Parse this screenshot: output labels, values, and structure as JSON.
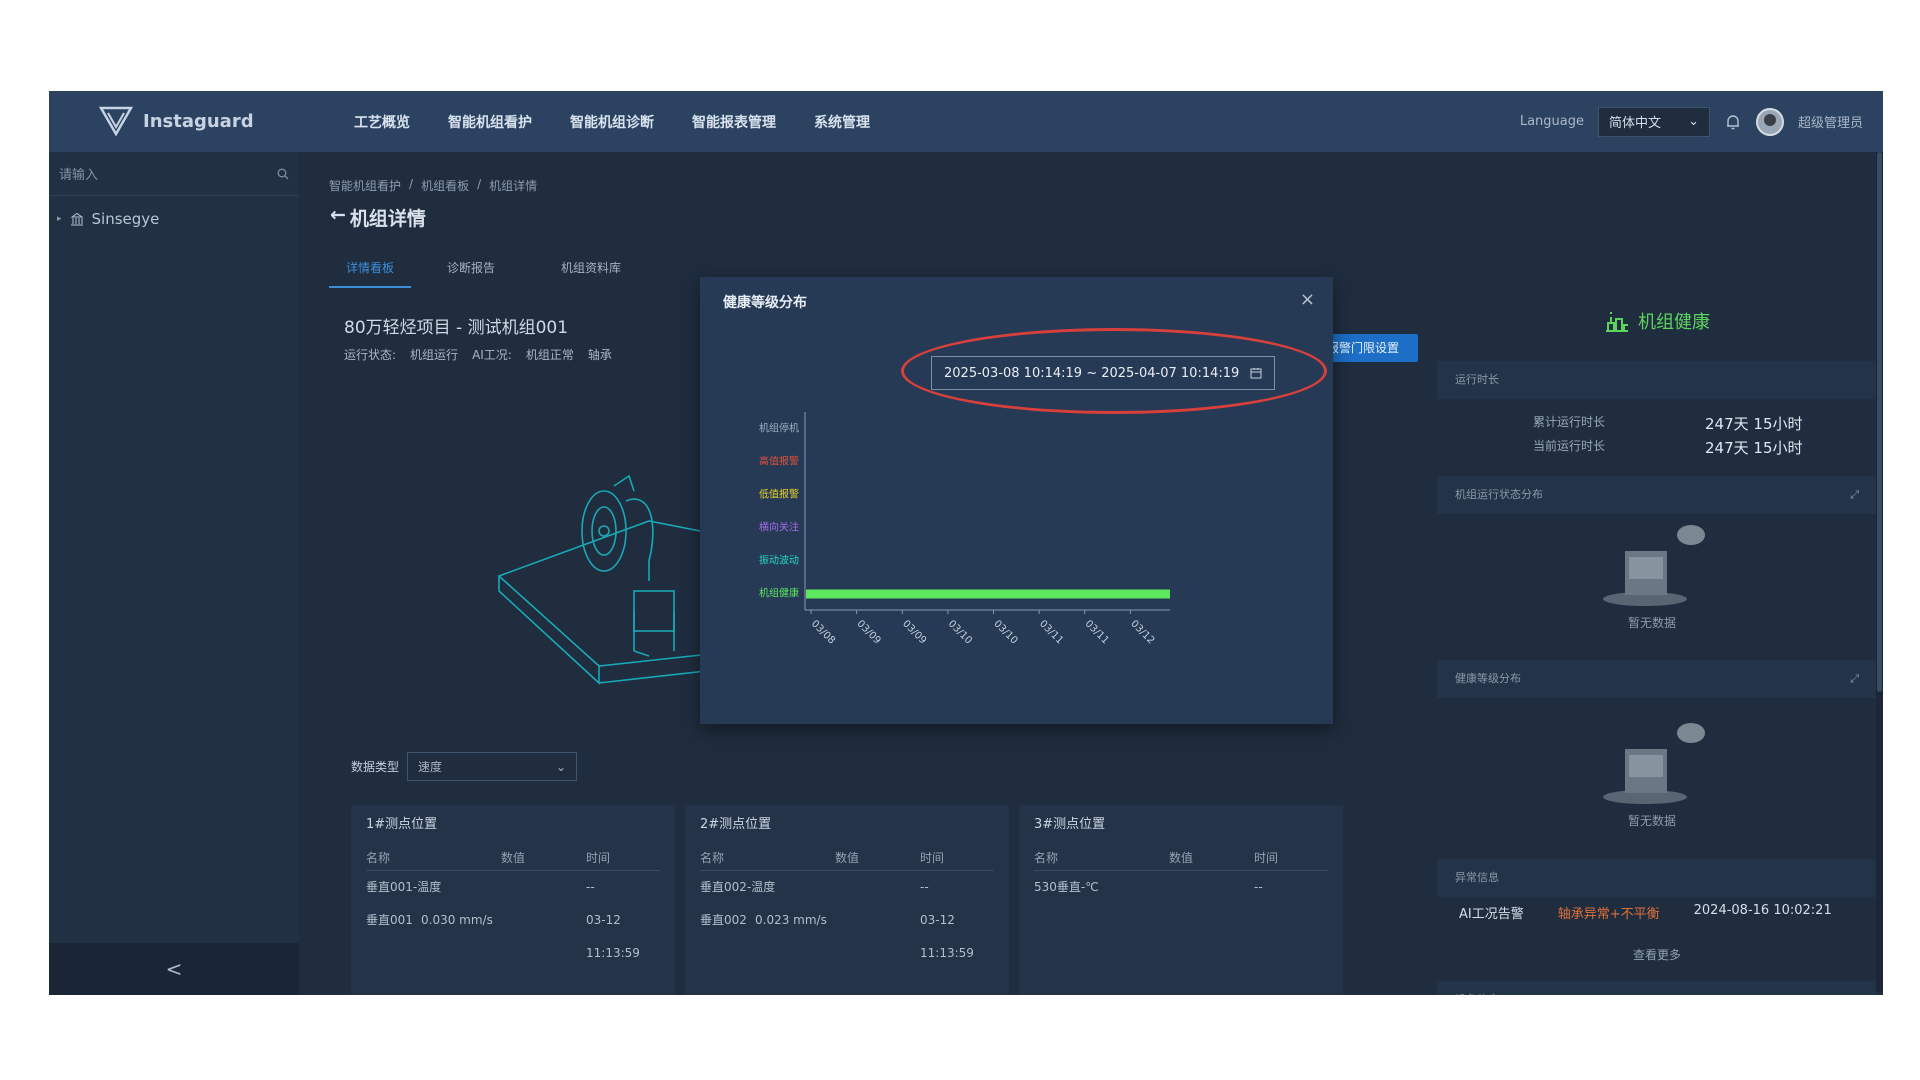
{
  "app": {
    "brand": "Instaguard"
  },
  "nav": {
    "items": [
      "工艺概览",
      "智能机组看护",
      "智能机组诊断",
      "智能报表管理",
      "系统管理"
    ]
  },
  "topright": {
    "language_label": "Language",
    "language_value": "简体中文",
    "user": "超级管理员"
  },
  "sidebar": {
    "search_placeholder": "请输入",
    "tree_root": "Sinsegye",
    "collapse": "<"
  },
  "breadcrumb": [
    "智能机组看护",
    "/",
    "机组看板",
    "/",
    "机组详情"
  ],
  "page": {
    "title": "机组详情",
    "tabs": [
      "详情看板",
      "诊断报告",
      "机组资料库"
    ],
    "project": "80万轻烃项目 - 测试机组001",
    "status": {
      "run_label": "运行状态:",
      "run_value": "机组运行",
      "ai_label": "AI工况:",
      "ai_value": "机组正常",
      "bearing_label": "轴承"
    },
    "alarm_button": "报警门限设置",
    "data_type_label": "数据类型",
    "data_type_value": "速度"
  },
  "measure_points": [
    {
      "title": "1#测点位置",
      "headers": [
        "名称",
        "数值",
        "时间"
      ],
      "rows": [
        [
          "垂直001-温度",
          "",
          "--"
        ],
        [
          "垂直001",
          "0.030 mm/s",
          "03-12 11:13:59"
        ]
      ]
    },
    {
      "title": "2#测点位置",
      "headers": [
        "名称",
        "数值",
        "时间"
      ],
      "rows": [
        [
          "垂直002-温度",
          "",
          "--"
        ],
        [
          "垂直002",
          "0.023 mm/s",
          "03-12 11:13:59"
        ]
      ]
    },
    {
      "title": "3#测点位置",
      "headers": [
        "名称",
        "数值",
        "时间"
      ],
      "rows": [
        [
          "530垂直-℃",
          "",
          "--"
        ]
      ]
    }
  ],
  "right_panel": {
    "title": "机组健康",
    "runtime_section": "运行时长",
    "cumulative_label": "累计运行时长",
    "cumulative_value": "247天 15小时",
    "current_label": "当前运行时长",
    "current_value": "247天 15小时",
    "state_dist_section": "机组运行状态分布",
    "health_dist_section": "健康等级分布",
    "no_data": "暂无数据",
    "anomaly_section": "异常信息",
    "anomaly": {
      "type": "AI工况告警",
      "desc": "轴承异常+不平衡",
      "time": "2024-08-16 10:02:21"
    },
    "more": "查看更多",
    "device_section": "设备信息"
  },
  "modal": {
    "title": "健康等级分布",
    "close": "×",
    "date_range": "2025-03-08 10:14:19 ~ 2025-04-07 10:14:19"
  },
  "chart_data": {
    "type": "bar",
    "orientation": "horizontal-timeline",
    "categories": [
      "机组停机",
      "高值报警",
      "低值报警",
      "横向关注",
      "振动波动",
      "机组健康"
    ],
    "category_colors": [
      "#9fb0c3",
      "#e0503a",
      "#e8d22a",
      "#a06ce6",
      "#26d6c4",
      "#5ee85e"
    ],
    "x": [
      "03/08",
      "03/09",
      "03/09",
      "03/10",
      "03/10",
      "03/11",
      "03/11",
      "03/12"
    ],
    "series": [
      {
        "category": "机组健康",
        "start": "03/08",
        "end": "03/12",
        "color": "#5ee85e"
      }
    ]
  }
}
